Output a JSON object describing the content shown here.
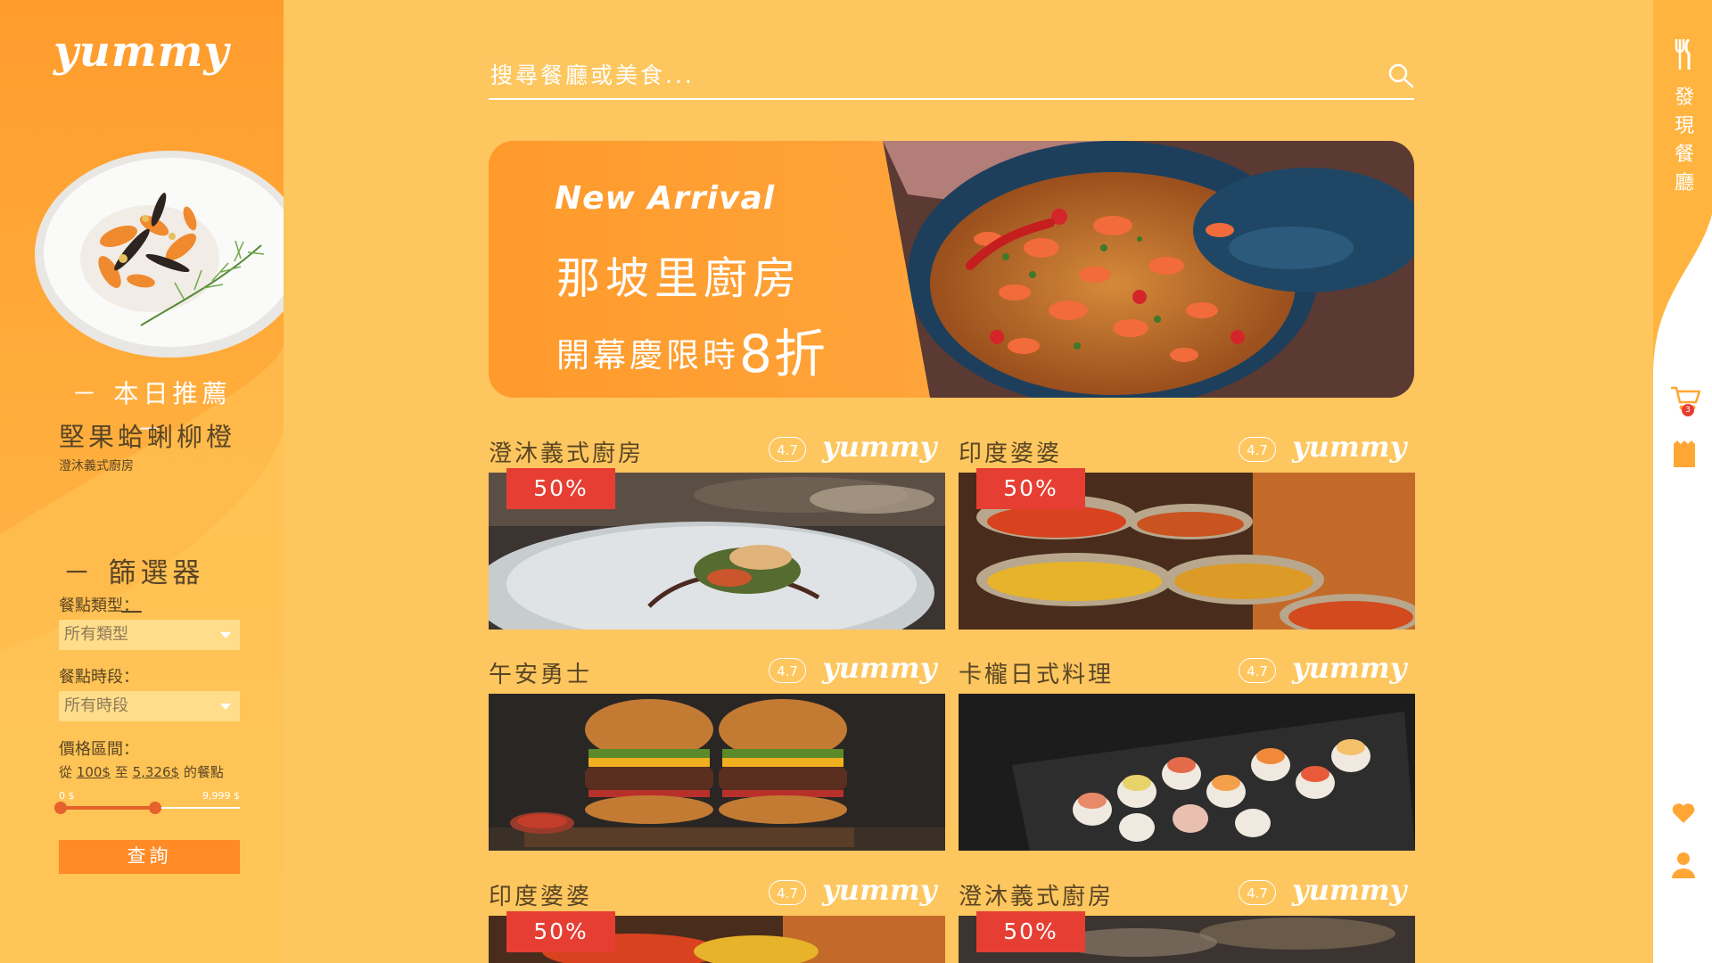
{
  "brand": {
    "logo": "yummy"
  },
  "today": {
    "title": "－ 本日推薦 －",
    "dish": "堅果蛤蜊柳橙",
    "restaurant": "澄沐義式廚房"
  },
  "filter": {
    "title": "－ 篩選器 －",
    "meal_type_label": "餐點類型：",
    "meal_type_value": "所有類型",
    "meal_time_label": "餐點時段：",
    "meal_time_value": "所有時段",
    "price_label": "價格區間：",
    "price_from_prefix": "從",
    "price_min": "100$",
    "price_to": "至",
    "price_max": "5,326$",
    "price_suffix": "的餐點",
    "range_min_label": "0 $",
    "range_max_label": "9,999 $",
    "range_min_fraction": 0.01,
    "range_max_fraction": 0.533,
    "query_button": "查詢"
  },
  "search": {
    "placeholder": "搜尋餐廳或美食..."
  },
  "banner": {
    "tag": "New Arrival",
    "title": "那坡里廚房",
    "subtitle": "開幕慶限時",
    "discount": "8折"
  },
  "cards": [
    {
      "name": "澄沐義式廚房",
      "rating": "4.7",
      "logo": "yummy",
      "badge": "50%"
    },
    {
      "name": "印度婆婆",
      "rating": "4.7",
      "logo": "yummy",
      "badge": "50%"
    },
    {
      "name": "午安勇士",
      "rating": "4.7",
      "logo": "yummy",
      "badge": ""
    },
    {
      "name": "卡櫳日式料理",
      "rating": "4.7",
      "logo": "yummy",
      "badge": ""
    },
    {
      "name": "印度婆婆",
      "rating": "4.7",
      "logo": "yummy",
      "badge": "50%"
    },
    {
      "name": "澄沐義式廚房",
      "rating": "4.7",
      "logo": "yummy",
      "badge": "50%"
    }
  ],
  "rail": {
    "discover_label": "發現餐廳",
    "cart_count": "3",
    "icons": [
      "utensils-icon",
      "cart-icon",
      "menu-card-icon",
      "heart-icon",
      "user-icon"
    ]
  },
  "colors": {
    "background": "#fdc65e",
    "sidebar": "#ff9c2c",
    "accent": "#ff8a26",
    "badge": "#e63e33",
    "text": "#5a4525"
  }
}
